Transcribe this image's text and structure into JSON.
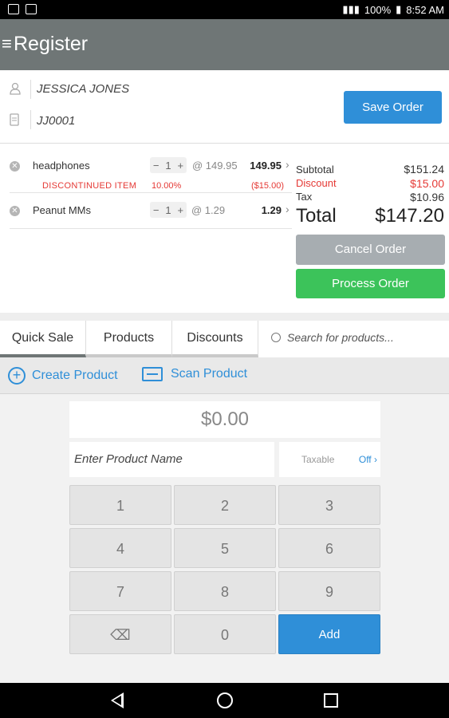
{
  "status_bar": {
    "battery": "100%",
    "time": "8:52 AM"
  },
  "app_bar": {
    "menu_icon": "≡",
    "title": "Register"
  },
  "customer": {
    "name": "JESSICA JONES",
    "id": "JJ0001",
    "save_label": "Save Order"
  },
  "cart": {
    "items": [
      {
        "name": "headphones",
        "qty": "1",
        "unit_price": "@ 149.95",
        "total": "149.95",
        "discount_label": "DISCONTINUED ITEM",
        "discount_pct": "10.00%",
        "discount_amt": "($15.00)"
      },
      {
        "name": "Peanut MMs",
        "qty": "1",
        "unit_price": "@ 1.29",
        "total": "1.29"
      }
    ]
  },
  "summary": {
    "subtotal_label": "Subtotal",
    "subtotal": "$151.24",
    "discount_label": "Discount",
    "discount": "$15.00",
    "tax_label": "Tax",
    "tax": "$10.96",
    "total_label": "Total",
    "total": "$147.20",
    "cancel_label": "Cancel Order",
    "process_label": "Process Order"
  },
  "tabs": [
    {
      "label": "Quick Sale",
      "active": true
    },
    {
      "label": "Products",
      "active": false
    },
    {
      "label": "Discounts",
      "active": false
    }
  ],
  "search": {
    "placeholder": "Search for products..."
  },
  "actions": {
    "create_label": "Create Product",
    "scan_label": "Scan Product"
  },
  "keypad": {
    "amount": "$0.00",
    "name_placeholder": "Enter Product Name",
    "taxable_label": "Taxable",
    "taxable_value": "Off",
    "keys": [
      "1",
      "2",
      "3",
      "4",
      "5",
      "6",
      "7",
      "8",
      "9",
      "⌫",
      "0",
      "Add"
    ]
  },
  "colors": {
    "accent": "#2f8fd8",
    "process": "#3cc35a",
    "cancel": "#a7adb1",
    "header": "#6f7676",
    "discount": "#e53935"
  }
}
